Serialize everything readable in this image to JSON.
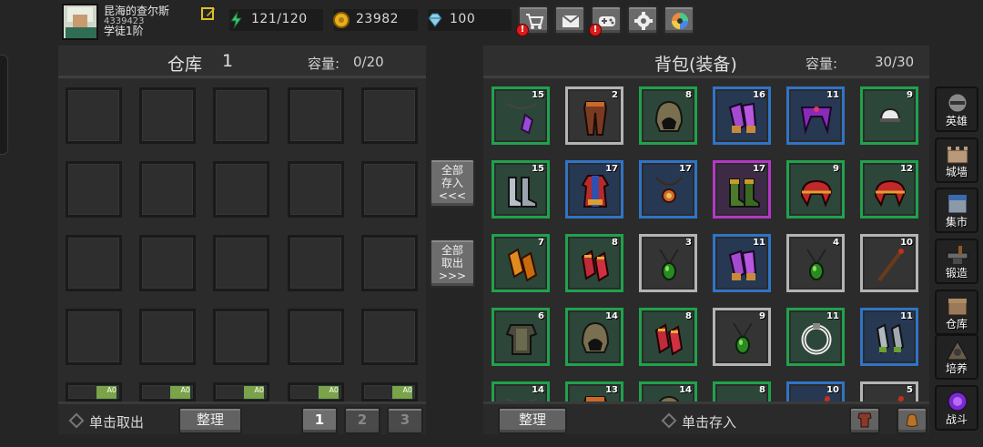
{
  "player": {
    "name": "昆海的查尔斯",
    "id": "4339423",
    "rank": "学徒1阶"
  },
  "resources": [
    {
      "icon": "energy-icon",
      "value": "121/120"
    },
    {
      "icon": "gold-coin-icon",
      "value": "23982"
    },
    {
      "icon": "gem-icon",
      "value": "100"
    }
  ],
  "toolbar": [
    {
      "name": "shop-button",
      "icon": "cart-icon",
      "alert": "!"
    },
    {
      "name": "mail-button",
      "icon": "mail-icon",
      "alert": ""
    },
    {
      "name": "gamepad-button",
      "icon": "gamepad-icon",
      "alert": "!"
    },
    {
      "name": "settings-button",
      "icon": "gear-icon",
      "alert": ""
    },
    {
      "name": "camera-button",
      "icon": "aperture-icon",
      "alert": ""
    }
  ],
  "warehouse": {
    "title": "仓库",
    "page": "1",
    "capacity_label": "容量:",
    "capacity": "0/20",
    "bottom_badge": "A0"
  },
  "backpack": {
    "title": "背包(装备)",
    "capacity_label": "容量:",
    "capacity": "30/30"
  },
  "middle": {
    "deposit_all": "全部\n存入\n<<<",
    "withdraw_all": "全部\n取出\n>>>"
  },
  "bottom": {
    "left_hint": "单击取出",
    "left_sort": "整理",
    "pages": [
      "1",
      "2",
      "3"
    ],
    "right_sort": "整理",
    "right_hint": "单击存入"
  },
  "sidebar": [
    {
      "name": "hero",
      "label": "英雄"
    },
    {
      "name": "city-wall",
      "label": "城墙"
    },
    {
      "name": "market",
      "label": "集市"
    },
    {
      "name": "forge",
      "label": "锻造"
    },
    {
      "name": "warehouse",
      "label": "仓库"
    },
    {
      "name": "train",
      "label": "培养"
    },
    {
      "name": "battle",
      "label": "战斗"
    }
  ],
  "items": [
    {
      "n": "15",
      "r": "g",
      "k": "amulet"
    },
    {
      "n": "2",
      "r": "w",
      "k": "pants"
    },
    {
      "n": "8",
      "r": "g",
      "k": "helm"
    },
    {
      "n": "16",
      "r": "b",
      "k": "legs"
    },
    {
      "n": "11",
      "r": "b",
      "k": "crown"
    },
    {
      "n": "9",
      "r": "g",
      "k": "cap"
    },
    {
      "n": "15",
      "r": "g",
      "k": "boots"
    },
    {
      "n": "17",
      "r": "b",
      "k": "robe"
    },
    {
      "n": "17",
      "r": "b",
      "k": "necklace"
    },
    {
      "n": "17",
      "r": "p",
      "k": "boots2"
    },
    {
      "n": "9",
      "r": "g",
      "k": "shoulder"
    },
    {
      "n": "12",
      "r": "g",
      "k": "shoulder"
    },
    {
      "n": "7",
      "r": "g",
      "k": "bracers"
    },
    {
      "n": "8",
      "r": "g",
      "k": "gloves"
    },
    {
      "n": "3",
      "r": "w",
      "k": "pendant"
    },
    {
      "n": "11",
      "r": "b",
      "k": "legs"
    },
    {
      "n": "4",
      "r": "w",
      "k": "pendant"
    },
    {
      "n": "10",
      "r": "w",
      "k": "staff"
    },
    {
      "n": "6",
      "r": "g",
      "k": "armor"
    },
    {
      "n": "14",
      "r": "g",
      "k": "helm"
    },
    {
      "n": "8",
      "r": "g",
      "k": "gloves"
    },
    {
      "n": "9",
      "r": "w",
      "k": "pendant"
    },
    {
      "n": "11",
      "r": "g",
      "k": "ring"
    },
    {
      "n": "11",
      "r": "b",
      "k": "gauntlet"
    },
    {
      "n": "14",
      "r": "g",
      "k": "amulet"
    },
    {
      "n": "13",
      "r": "g",
      "k": "pants"
    },
    {
      "n": "14",
      "r": "g",
      "k": "helm"
    },
    {
      "n": "8",
      "r": "g",
      "k": "cap"
    },
    {
      "n": "10",
      "r": "b",
      "k": "staff"
    },
    {
      "n": "5",
      "r": "w",
      "k": "staff"
    }
  ]
}
